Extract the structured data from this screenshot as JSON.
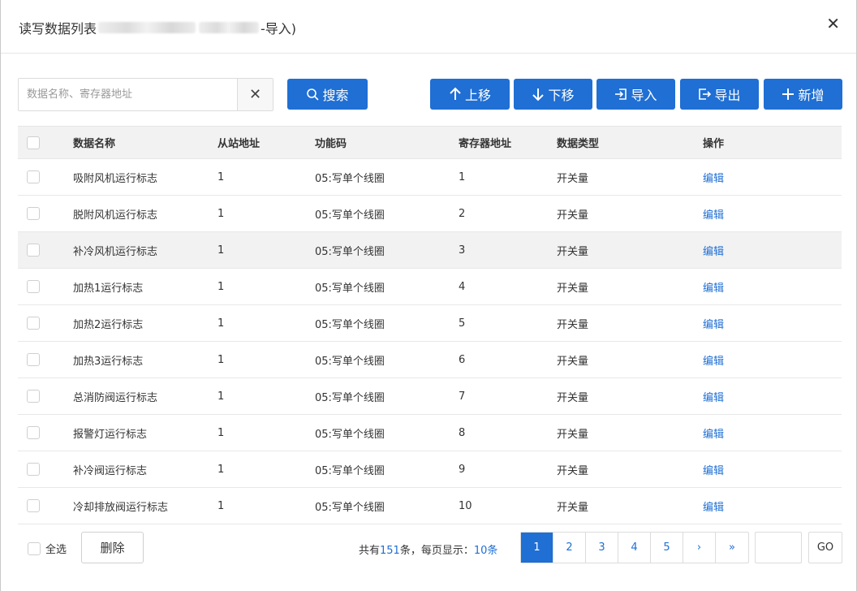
{
  "dialog": {
    "title_prefix": "读写数据列表",
    "title_suffix": "-导入)",
    "close_glyph": "✕"
  },
  "search": {
    "placeholder": "数据名称、寄存器地址",
    "value": "",
    "clear_glyph": "✕",
    "search_label": "搜索"
  },
  "toolbar": {
    "up_label": "上移",
    "down_label": "下移",
    "import_label": "导入",
    "export_label": "导出",
    "add_label": "新增"
  },
  "table": {
    "headers": [
      "数据名称",
      "从站地址",
      "功能码",
      "寄存器地址",
      "数据类型",
      "操作"
    ],
    "rows": [
      {
        "name": "吸附风机运行标志",
        "slave": "1",
        "func": "05:写单个线圈",
        "reg": "1",
        "type": "开关量",
        "action": "编辑"
      },
      {
        "name": "脱附风机运行标志",
        "slave": "1",
        "func": "05:写单个线圈",
        "reg": "2",
        "type": "开关量",
        "action": "编辑"
      },
      {
        "name": "补冷风机运行标志",
        "slave": "1",
        "func": "05:写单个线圈",
        "reg": "3",
        "type": "开关量",
        "action": "编辑"
      },
      {
        "name": "加热1运行标志",
        "slave": "1",
        "func": "05:写单个线圈",
        "reg": "4",
        "type": "开关量",
        "action": "编辑"
      },
      {
        "name": "加热2运行标志",
        "slave": "1",
        "func": "05:写单个线圈",
        "reg": "5",
        "type": "开关量",
        "action": "编辑"
      },
      {
        "name": "加热3运行标志",
        "slave": "1",
        "func": "05:写单个线圈",
        "reg": "6",
        "type": "开关量",
        "action": "编辑"
      },
      {
        "name": "总消防阀运行标志",
        "slave": "1",
        "func": "05:写单个线圈",
        "reg": "7",
        "type": "开关量",
        "action": "编辑"
      },
      {
        "name": "报警灯运行标志",
        "slave": "1",
        "func": "05:写单个线圈",
        "reg": "8",
        "type": "开关量",
        "action": "编辑"
      },
      {
        "name": "补冷阀运行标志",
        "slave": "1",
        "func": "05:写单个线圈",
        "reg": "9",
        "type": "开关量",
        "action": "编辑"
      },
      {
        "name": "冷却排放阀运行标志",
        "slave": "1",
        "func": "05:写单个线圈",
        "reg": "10",
        "type": "开关量",
        "action": "编辑"
      }
    ],
    "highlighted_row": 2
  },
  "footer": {
    "select_all_label": "全选",
    "delete_label": "删除",
    "total_prefix": "共有",
    "total_count": "151",
    "total_mid": "条，每页显示：",
    "page_size": "10条",
    "pages": [
      "1",
      "2",
      "3",
      "4",
      "5",
      "›",
      "»"
    ],
    "current_page": "1",
    "goto_value": "",
    "go_label": "GO"
  },
  "colors": {
    "accent": "#1f6fd4",
    "header_bg": "#f2f2f2",
    "border": "#e5e5e5"
  }
}
